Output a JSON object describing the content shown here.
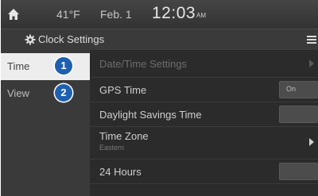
{
  "status_bar": {
    "temperature": "41°F",
    "date": "Feb. 1",
    "time": "12:03",
    "ampm": "AM"
  },
  "header": {
    "title": "Clock Settings"
  },
  "tabs": [
    {
      "label": "Time",
      "badge": "1",
      "selected": true
    },
    {
      "label": "View",
      "badge": "2",
      "selected": false
    }
  ],
  "settings": {
    "date_time_settings": {
      "label": "Date/Time Settings"
    },
    "gps_time": {
      "label": "GPS Time",
      "value": "On"
    },
    "daylight_savings": {
      "label": "Daylight Savings Time",
      "value": ""
    },
    "time_zone": {
      "label": "Time Zone",
      "value": "Eastern"
    },
    "hours_24": {
      "label": "24 Hours",
      "value": ""
    }
  },
  "colors": {
    "badge": "#1f5fb0",
    "selected_tab": "#ededed",
    "background": "#262626"
  }
}
